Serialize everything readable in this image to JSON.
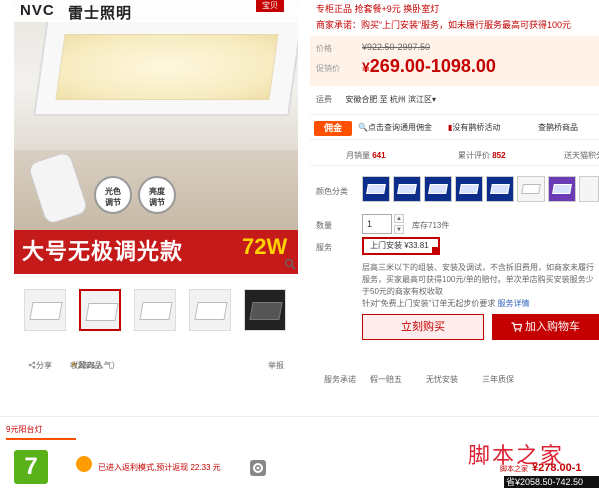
{
  "product_image": {
    "brand_logo": "NVC",
    "brand_cn": "雷士照明",
    "corner_tag": "宝贝",
    "bubble_1": "光色\n调节",
    "bubble_2": "亮度\n调节",
    "banner_text": "大号无极调光款",
    "banner_watt": "72W"
  },
  "thumbnails": [
    "thumb-1",
    "thumb-2",
    "thumb-3",
    "thumb-4",
    "thumb-5"
  ],
  "share_row": {
    "share": "分享",
    "favorite": "收藏商品",
    "popularity": "（2321人气）",
    "report": "举报"
  },
  "promos": {
    "line1": "专柜正品 抢套餐+9元 换卧室灯",
    "line2": "商家承诺：购买“上门安装”服务，如未履行服务最高可获得100元"
  },
  "price": {
    "label": "价格",
    "old_value": "¥922.50-2997.50",
    "promo_label": "促销价",
    "currency": "¥",
    "promo_value": "269.00-1098.00"
  },
  "shipping": {
    "label": "运费",
    "value": "安徽合肥 至 杭州",
    "dest": "滨江区"
  },
  "service_bar": {
    "badge": "佣金",
    "item1": "点击查询通用佣金",
    "item2": "没有鹊桥活动",
    "item3": "查鹊桥商品"
  },
  "stats": {
    "sales_label": "月销量",
    "sales": "641",
    "reviews_label": "累计评价",
    "reviews": "852",
    "points": "送天猫积分"
  },
  "sku": {
    "color_label": "颜色分类",
    "qty_label": "数量",
    "qty_value": "1",
    "stock": "库存713件",
    "service_label": "服务",
    "service_option": "上门安装  ¥33.81",
    "service_desc": "层高三米以下的组装、安装及调试，不含拆旧费用，如商家未履行服务，买家最高可获得100元/单的赔付。单次单店购买安装服务少于50元的商家有权收取",
    "service_desc2": "针对“免费上门安装”订单无起步价要求",
    "service_link": "服务详情"
  },
  "actions": {
    "buy": "立刻购买",
    "cart": "加入购物车"
  },
  "promise": {
    "label": "服务承诺",
    "p1": "假一赔五",
    "p2": "无忧安装",
    "p3": "三年质保"
  },
  "bottom": {
    "section_title": "9元阳台灯",
    "plugin_logo": "7",
    "plugin_text": "已进入返利模式,预计返现 22.33 元"
  },
  "watermark": {
    "main": "脚本之家",
    "sub": "脚本之家",
    "price": "¥278.00-1",
    "bar": "省¥2058.50-742.50"
  },
  "colors": {
    "accent": "#c40000",
    "orange": "#ff5000",
    "green": "#59b21a"
  }
}
